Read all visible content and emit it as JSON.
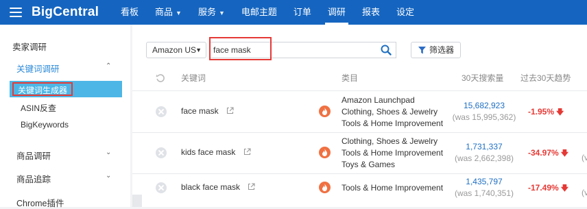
{
  "brand": {
    "part1": "Big",
    "part2": "Central"
  },
  "nav": [
    {
      "label": "看板",
      "has_menu": false
    },
    {
      "label": "商品",
      "has_menu": true
    },
    {
      "label": "服务",
      "has_menu": true
    },
    {
      "label": "电邮主题",
      "has_menu": false
    },
    {
      "label": "订单",
      "has_menu": false
    },
    {
      "label": "调研",
      "has_menu": false,
      "active": true
    },
    {
      "label": "报表",
      "has_menu": false
    },
    {
      "label": "设定",
      "has_menu": false
    }
  ],
  "sidebar": {
    "seller_research": "卖家调研",
    "keyword_research": "关键词调研",
    "keyword_generator": "关键词生成器",
    "asin_reverse": "ASIN反查",
    "bigkeywords": "BigKeywords",
    "product_research": "商品调研",
    "product_tracking": "商品追踪",
    "chrome_plugin": "Chrome插件"
  },
  "toolbar": {
    "marketplace": "Amazon US",
    "search_value": "face mask",
    "filter_label": "筛选器"
  },
  "table": {
    "headers": {
      "keyword": "关键词",
      "category": "类目",
      "volume": "30天搜索量",
      "trend": "过去30天趋势"
    },
    "rows": [
      {
        "keyword": "face mask",
        "categories": [
          "Amazon Launchpad",
          "Clothing, Shoes & Jewelry",
          "Tools & Home Improvement"
        ],
        "volume": "15,682,923",
        "was": "(was 15,995,362)",
        "trend": "-1.95%",
        "cut": ""
      },
      {
        "keyword": "kids face mask",
        "categories": [
          "Clothing, Shoes & Jewelry",
          "Tools & Home Improvement",
          "Toys & Games"
        ],
        "volume": "1,731,337",
        "was": "(was 2,662,398)",
        "trend": "-34.97%",
        "cut": "(v"
      },
      {
        "keyword": "black face mask",
        "categories": [
          "Tools & Home Improvement"
        ],
        "volume": "1,435,797",
        "was": "(was 1,740,351)",
        "trend": "-17.49%",
        "cut": "(v"
      }
    ]
  },
  "colors": {
    "nav_bg": "#1565c0",
    "active_sidebar": "#4db6e6",
    "highlight_border": "#e53935",
    "link": "#1e6fc2",
    "trend_down": "#e53935",
    "flame": "#f07142"
  },
  "icons": [
    "menu-icon",
    "chevron-down-icon",
    "chevron-up-icon",
    "search-icon",
    "filter-icon",
    "refresh-icon",
    "close-circle-icon",
    "external-link-icon",
    "flame-icon",
    "arrow-down-icon"
  ]
}
